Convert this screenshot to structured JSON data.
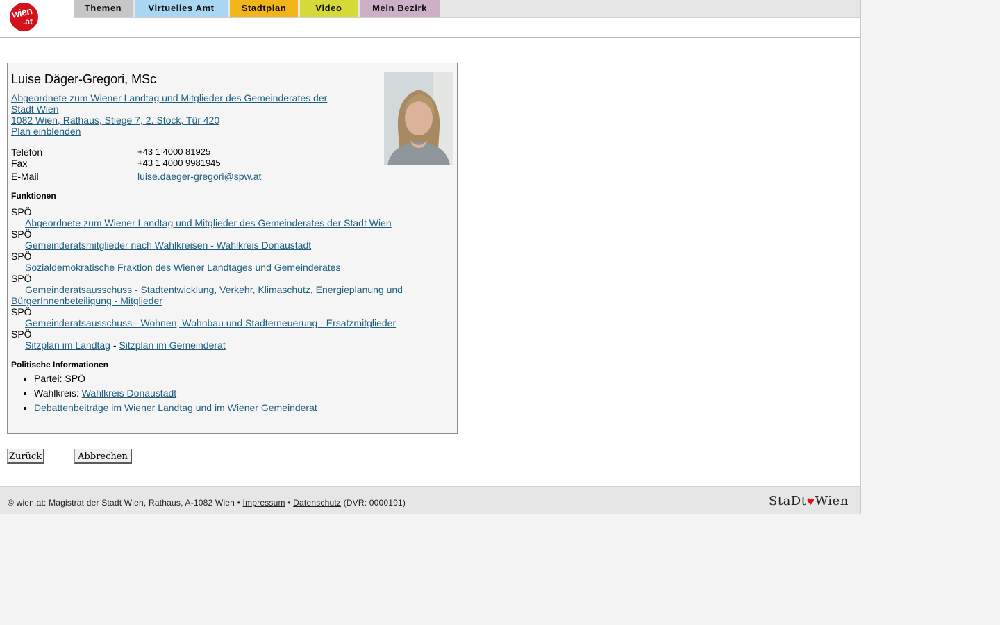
{
  "header": {
    "logo_line1": "wien",
    "logo_line2": ".at",
    "nav": [
      "Themen",
      "Virtuelles Amt",
      "Stadtplan",
      "Video",
      "Mein Bezirk"
    ],
    "nav_colors": [
      "#c6c6c6",
      "#a9d6f3",
      "#f2b41b",
      "#d6da38",
      "#cbb0c8"
    ]
  },
  "person": {
    "name": "Luise Däger-Gregori, MSc",
    "role_line1": "Abgeordnete zum Wiener Landtag und Mitglieder des Gemeinderates der",
    "role_line2": "Stadt Wien ",
    "address": "1082 Wien, Rathaus, Stiege 7, 2. Stock, Tür 420",
    "plan": "Plan einblenden",
    "contacts": {
      "phone_label": "Telefon",
      "phone": "+43 1 4000 81925",
      "fax_label": "Fax",
      "fax": "+43 1 4000 9981945",
      "email_label": "E-Mail",
      "email": "luise.daeger-gregori@spw.at"
    }
  },
  "functions": {
    "title": "Funktionen",
    "party": "SPÖ",
    "items": [
      "Abgeordnete zum Wiener Landtag und Mitglieder des Gemeinderates der Stadt Wien",
      "Gemeinderatsmitglieder nach Wahlkreisen - Wahlkreis Donaustadt",
      "Sozialdemokratische Fraktion des Wiener Landtages und Gemeinderates",
      "Gemeinderatsausschuss - Stadtentwicklung, Verkehr, Klimaschutz, Energieplanung und",
      "BürgerInnenbeteiligung - Mitglieder",
      "Gemeinderatsausschuss - Wohnen, Wohnbau und Stadterneuerung - Ersatzmitglieder"
    ],
    "sitzplan_landtag": "Sitzplan im Landtag",
    "separator": "-",
    "sitzplan_gemeinderat": "Sitzplan im Gemeinderat"
  },
  "political": {
    "title": "Politische Informationen",
    "party_text": "Partei: SPÖ",
    "wahlkreis_label": "Wahlkreis: ",
    "wahlkreis_link": "Wahlkreis Donaustadt",
    "debates": "Debattenbeiträge im Wiener Landtag und im Wiener Gemeinderat"
  },
  "buttons": {
    "back": "Zurück",
    "cancel": "Abbrechen"
  },
  "footer": {
    "copyright": "© wien.at: Magistrat der Stadt Wien, Rathaus, A-1082 Wien • ",
    "impressum": "Impressum",
    "sep": " • ",
    "datenschutz": "Datenschutz",
    "dvr": " (DVR: 0000191)",
    "brand_left": "StaDt",
    "brand_right": "Wien"
  }
}
